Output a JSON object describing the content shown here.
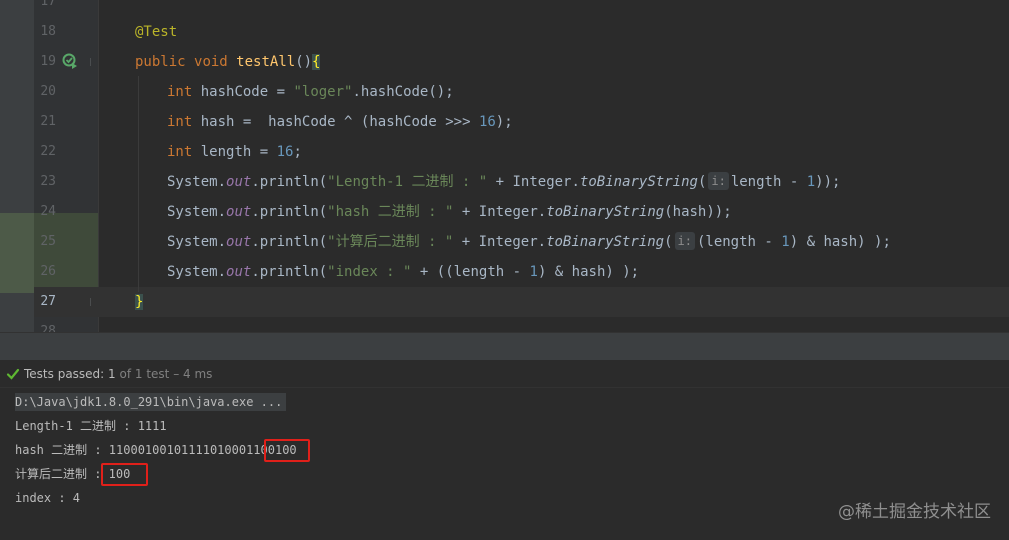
{
  "editor": {
    "line_numbers": [
      "17",
      "18",
      "19",
      "20",
      "21",
      "22",
      "23",
      "24",
      "25",
      "26",
      "27",
      "28"
    ],
    "current_line": "27",
    "code": {
      "l18_annotation": "@Test",
      "l19_public": "public",
      "l19_void": "void",
      "l19_name": "testAll",
      "l19_parens": "()",
      "l19_brace": "{",
      "l20_type": "int",
      "l20_var": "hashCode",
      "l20_eq": " = ",
      "l20_str": "\"loger\"",
      "l20_dot": ".",
      "l20_call": "hashCode",
      "l20_end": "();",
      "l21_type": "int",
      "l21_var": "hash",
      "l21_eq": " =  ",
      "l21_a": "hashCode",
      "l21_op": " ^ ",
      "l21_open": "(",
      "l21_b": "hashCode",
      "l21_shift": " >>> ",
      "l21_num": "16",
      "l21_end": ");",
      "l22_type": "int",
      "l22_var": "length",
      "l22_eq": " = ",
      "l22_num": "16",
      "l22_end": ";",
      "l23_sys": "System.",
      "l23_out": "out",
      "l23_println": ".println(",
      "l23_str": "\"Length-1 二进制 : \"",
      "l23_plus": " + ",
      "l23_cls": "Integer.",
      "l23_m": "toBinaryString",
      "l23_open": "(",
      "l23_hint": "i:",
      "l23_arg": "length",
      "l23_minus": " - ",
      "l23_num": "1",
      "l23_end": "));",
      "l24_sys": "System.",
      "l24_out": "out",
      "l24_println": ".println(",
      "l24_str": "\"hash 二进制 : \"",
      "l24_plus": " + ",
      "l24_cls": "Integer.",
      "l24_m": "toBinaryString",
      "l24_args": "(hash));",
      "l25_sys": "System.",
      "l25_out": "out",
      "l25_println": ".println(",
      "l25_str": "\"计算后二进制 : \"",
      "l25_plus": " + ",
      "l25_cls": "Integer.",
      "l25_m": "toBinaryString",
      "l25_open": "(",
      "l25_hint": "i:",
      "l25_a": "(length",
      "l25_minus": " - ",
      "l25_num": "1",
      "l25_amp": ") & ",
      "l25_end": "hash) );",
      "l26_sys": "System.",
      "l26_out": "out",
      "l26_println": ".println(",
      "l26_str": "\"index : \"",
      "l26_plus": " + ",
      "l26_a": "((length",
      "l26_minus": " - ",
      "l26_num": "1",
      "l26_amp": ") & ",
      "l26_end": "hash) );",
      "l27_brace": "}"
    }
  },
  "test_status": {
    "passed_label": "Tests passed:",
    "passed_count": "1",
    "detail": "of 1 test – 4 ms"
  },
  "console": {
    "command": "D:\\Java\\jdk1.8.0_291\\bin\\java.exe ...",
    "line1": "Length-1 二进制 : 1111",
    "line2": "hash 二进制 : 11000100101111010001100100",
    "line3": "计算后二进制 : 100",
    "line4": "index : 4"
  },
  "watermark": "@稀土掘金技术社区",
  "colors": {
    "editor_bg": "#2b2b2b",
    "keyword": "#cc7832",
    "string": "#6a8759",
    "number": "#6897bb",
    "annotation": "#bbb529",
    "test_pass": "#5fb832",
    "highlight_box": "#e0201a"
  },
  "icons": {
    "run_gutter": "run-test-icon",
    "status": "check-icon"
  }
}
